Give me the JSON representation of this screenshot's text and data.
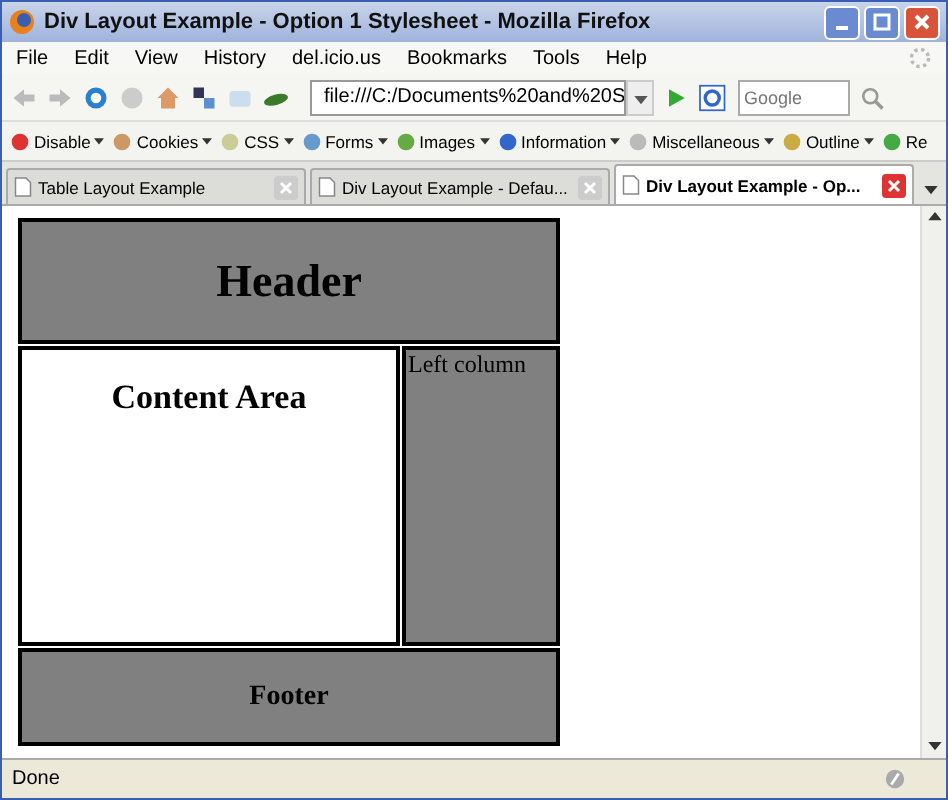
{
  "window": {
    "title": "Div Layout Example - Option 1 Stylesheet - Mozilla Firefox"
  },
  "menu": [
    "File",
    "Edit",
    "View",
    "History",
    "del.icio.us",
    "Bookmarks",
    "Tools",
    "Help"
  ],
  "address": {
    "value": "file:///C:/Documents%20and%20S"
  },
  "search": {
    "placeholder": "Google"
  },
  "dev_toolbar": [
    "Disable",
    "Cookies",
    "CSS",
    "Forms",
    "Images",
    "Information",
    "Miscellaneous",
    "Outline",
    "Re"
  ],
  "tabs": [
    {
      "label": "Table Layout Example",
      "selected": false
    },
    {
      "label": "Div Layout Example - Defau...",
      "selected": false
    },
    {
      "label": "Div Layout Example - Op...",
      "selected": true
    }
  ],
  "page": {
    "header": "Header",
    "content": "Content Area",
    "left_column": "Left column",
    "footer": "Footer"
  },
  "status_bar": "Done"
}
